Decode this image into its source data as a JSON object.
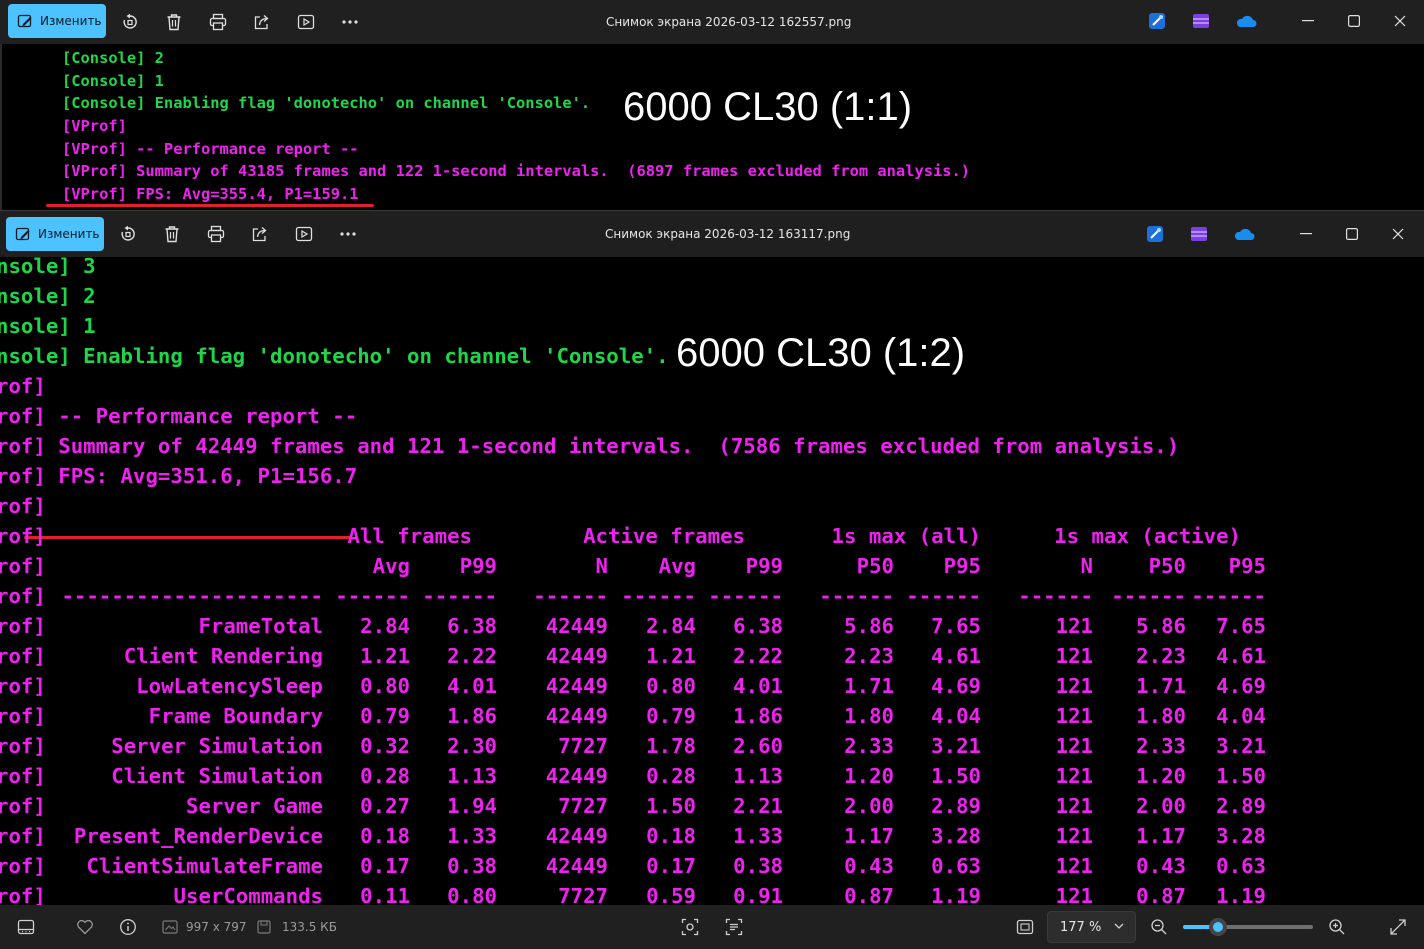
{
  "window1": {
    "edit_label": "Изменить",
    "title": "Снимок экрана 2026-03-12 162557.png",
    "lines": [
      {
        "text": "[Console] 2",
        "color": "green"
      },
      {
        "text": "[Console] 1",
        "color": "green"
      },
      {
        "text": "[Console] Enabling flag 'donotecho' on channel 'Console'.",
        "color": "green"
      },
      {
        "text": "[VProf]",
        "color": "magenta"
      },
      {
        "text": "[VProf] -- Performance report --",
        "color": "magenta"
      },
      {
        "text": "[VProf] Summary of 43185 frames and 122 1-second intervals.  (6897 frames excluded from analysis.)",
        "color": "magenta"
      },
      {
        "text": "[VProf] FPS: Avg=355.4, P1=159.1",
        "color": "magenta"
      }
    ],
    "overlay_label": "6000 CL30 (1:1)"
  },
  "window2": {
    "edit_label": "Изменить",
    "title": "Снимок экрана 2026-03-12 163117.png",
    "lines": [
      {
        "text": "nsole] 3",
        "color": "green"
      },
      {
        "text": "nsole] 2",
        "color": "green"
      },
      {
        "text": "nsole] 1",
        "color": "green"
      },
      {
        "text": "nsole] Enabling flag 'donotecho' on channel 'Console'.",
        "color": "green"
      },
      {
        "text": "rof]",
        "color": "magenta"
      },
      {
        "text": "rof] -- Performance report --",
        "color": "magenta"
      },
      {
        "text": "rof] Summary of 42449 frames and 121 1-second intervals.  (7586 frames excluded from analysis.)",
        "color": "magenta"
      },
      {
        "text": "rof] FPS: Avg=351.6, P1=156.7",
        "color": "magenta"
      },
      {
        "text": "rof]",
        "color": "magenta"
      }
    ],
    "overlay_label": "6000 CL30 (1:2)",
    "table": {
      "prefix": "rof]",
      "group_headers": [
        "All frames",
        "Active frames",
        "1s max (all)",
        "1s max (active)"
      ],
      "col_headers": [
        "Avg",
        "P99",
        "N",
        "Avg",
        "P99",
        "P50",
        "P95",
        "N",
        "P50",
        "P95"
      ],
      "separator_cells": [
        "---------------------",
        "------",
        "------",
        "------",
        "------",
        "------",
        "------",
        "------",
        "------",
        "------",
        "------"
      ],
      "rows": [
        {
          "name": "FrameTotal",
          "values": [
            "2.84",
            "6.38",
            "42449",
            "2.84",
            "6.38",
            "5.86",
            "7.65",
            "121",
            "5.86",
            "7.65"
          ]
        },
        {
          "name": "Client Rendering",
          "values": [
            "1.21",
            "2.22",
            "42449",
            "1.21",
            "2.22",
            "2.23",
            "4.61",
            "121",
            "2.23",
            "4.61"
          ]
        },
        {
          "name": "LowLatencySleep",
          "values": [
            "0.80",
            "4.01",
            "42449",
            "0.80",
            "4.01",
            "1.71",
            "4.69",
            "121",
            "1.71",
            "4.69"
          ]
        },
        {
          "name": "Frame Boundary",
          "values": [
            "0.79",
            "1.86",
            "42449",
            "0.79",
            "1.86",
            "1.80",
            "4.04",
            "121",
            "1.80",
            "4.04"
          ]
        },
        {
          "name": "Server Simulation",
          "values": [
            "0.32",
            "2.30",
            "7727",
            "1.78",
            "2.60",
            "2.33",
            "3.21",
            "121",
            "2.33",
            "3.21"
          ]
        },
        {
          "name": "Client Simulation",
          "values": [
            "0.28",
            "1.13",
            "42449",
            "0.28",
            "1.13",
            "1.20",
            "1.50",
            "121",
            "1.20",
            "1.50"
          ]
        },
        {
          "name": "Server Game",
          "values": [
            "0.27",
            "1.94",
            "7727",
            "1.50",
            "2.21",
            "2.00",
            "2.89",
            "121",
            "2.00",
            "2.89"
          ]
        },
        {
          "name": "Present_RenderDevice",
          "values": [
            "0.18",
            "1.33",
            "42449",
            "0.18",
            "1.33",
            "1.17",
            "3.28",
            "121",
            "1.17",
            "3.28"
          ]
        },
        {
          "name": "ClientSimulateFrame",
          "values": [
            "0.17",
            "0.38",
            "42449",
            "0.17",
            "0.38",
            "0.43",
            "0.63",
            "121",
            "0.43",
            "0.63"
          ]
        },
        {
          "name": "UserCommands",
          "values": [
            "0.11",
            "0.80",
            "7727",
            "0.59",
            "0.91",
            "0.87",
            "1.19",
            "121",
            "0.87",
            "1.19"
          ]
        }
      ]
    }
  },
  "statusbar": {
    "dimensions": "997 x 797",
    "file_size": "133.5 КБ",
    "zoom": "177 %",
    "zoom_level": 0.27
  },
  "colors": {
    "accent": "#4cc2ff",
    "console_green": "#1fd64a",
    "console_magenta": "#ee22ee",
    "underline_red": "#e0202a"
  }
}
